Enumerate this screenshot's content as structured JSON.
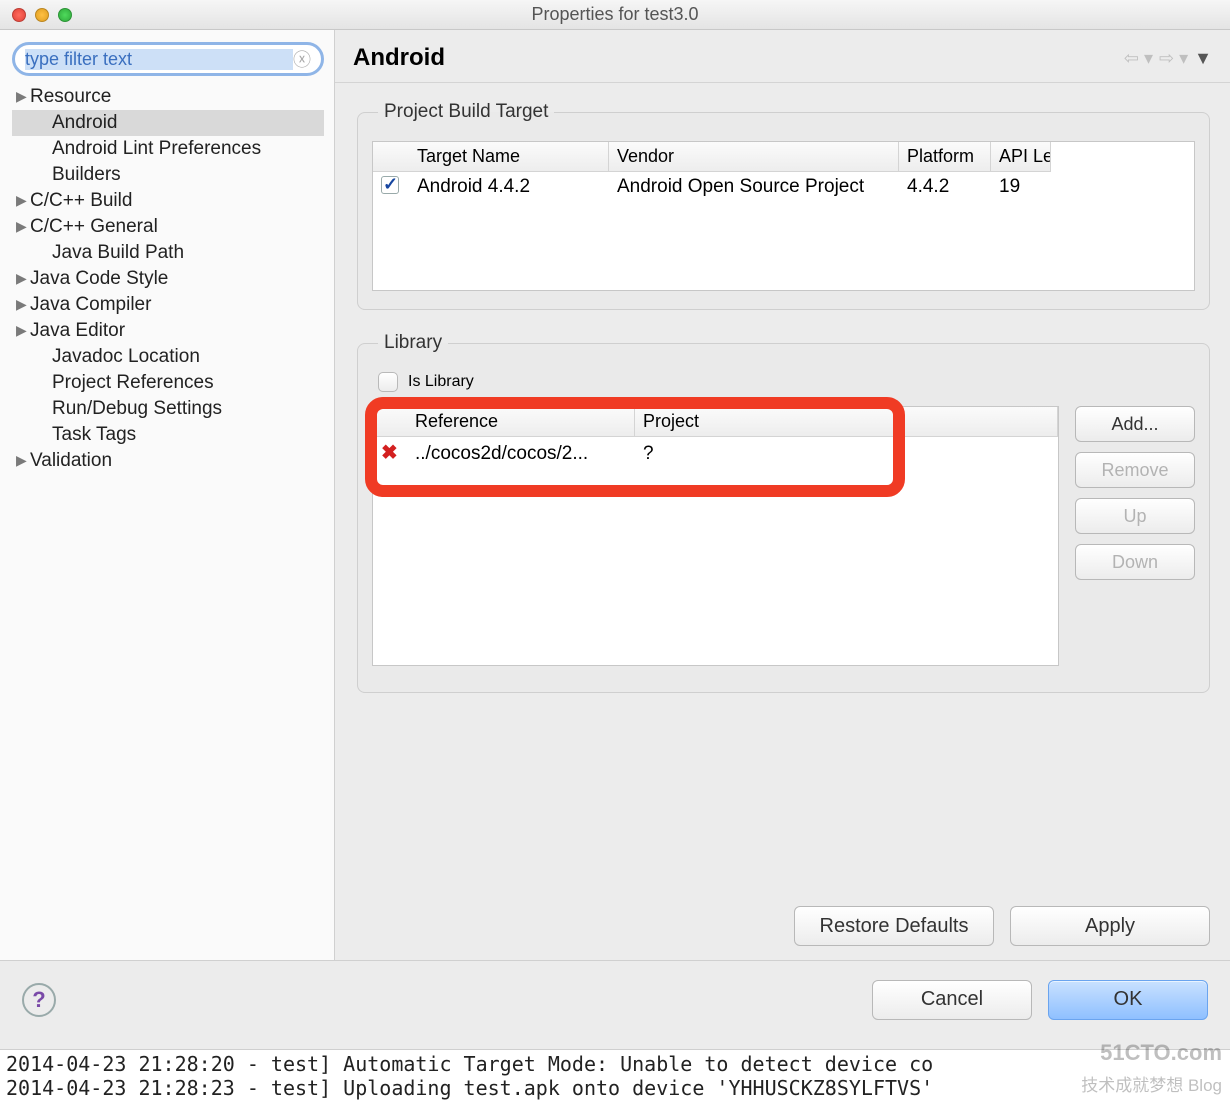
{
  "window": {
    "title": "Properties for test3.0"
  },
  "filter": {
    "value": "type filter text"
  },
  "tree": {
    "items": [
      {
        "label": "Resource",
        "hasCaret": true,
        "level": 0
      },
      {
        "label": "Android",
        "hasCaret": false,
        "level": 1,
        "selected": true
      },
      {
        "label": "Android Lint Preferences",
        "hasCaret": false,
        "level": 1
      },
      {
        "label": "Builders",
        "hasCaret": false,
        "level": 1
      },
      {
        "label": "C/C++ Build",
        "hasCaret": true,
        "level": 0
      },
      {
        "label": "C/C++ General",
        "hasCaret": true,
        "level": 0
      },
      {
        "label": "Java Build Path",
        "hasCaret": false,
        "level": 1
      },
      {
        "label": "Java Code Style",
        "hasCaret": true,
        "level": 0
      },
      {
        "label": "Java Compiler",
        "hasCaret": true,
        "level": 0
      },
      {
        "label": "Java Editor",
        "hasCaret": true,
        "level": 0
      },
      {
        "label": "Javadoc Location",
        "hasCaret": false,
        "level": 1
      },
      {
        "label": "Project References",
        "hasCaret": false,
        "level": 1
      },
      {
        "label": "Run/Debug Settings",
        "hasCaret": false,
        "level": 1
      },
      {
        "label": "Task Tags",
        "hasCaret": false,
        "level": 1
      },
      {
        "label": "Validation",
        "hasCaret": true,
        "level": 0
      }
    ]
  },
  "page": {
    "title": "Android"
  },
  "buildTarget": {
    "groupTitle": "Project Build Target",
    "columns": {
      "name": "Target Name",
      "vendor": "Vendor",
      "platform": "Platform",
      "api": "API Le"
    },
    "rows": [
      {
        "checked": true,
        "name": "Android 4.4.2",
        "vendor": "Android Open Source Project",
        "platform": "4.4.2",
        "api": "19"
      }
    ]
  },
  "library": {
    "groupTitle": "Library",
    "isLibraryLabel": "Is Library",
    "columns": {
      "reference": "Reference",
      "project": "Project"
    },
    "rows": [
      {
        "status": "error",
        "reference": "../cocos2d/cocos/2...",
        "project": "?"
      }
    ],
    "buttons": {
      "add": "Add...",
      "remove": "Remove",
      "up": "Up",
      "down": "Down"
    }
  },
  "footer": {
    "restore": "Restore Defaults",
    "apply": "Apply"
  },
  "dialog": {
    "help": "?",
    "cancel": "Cancel",
    "ok": "OK"
  },
  "console": {
    "line1": "2014-04-23 21:28:20 - test] Automatic Target Mode: Unable to detect device co",
    "line2": "2014-04-23 21:28:23 - test] Uploading test.apk onto device 'YHHUSCKZ8SYLFTVS'"
  },
  "watermark": {
    "main": "51CTO.com",
    "sub": "技术成就梦想 Blog"
  }
}
